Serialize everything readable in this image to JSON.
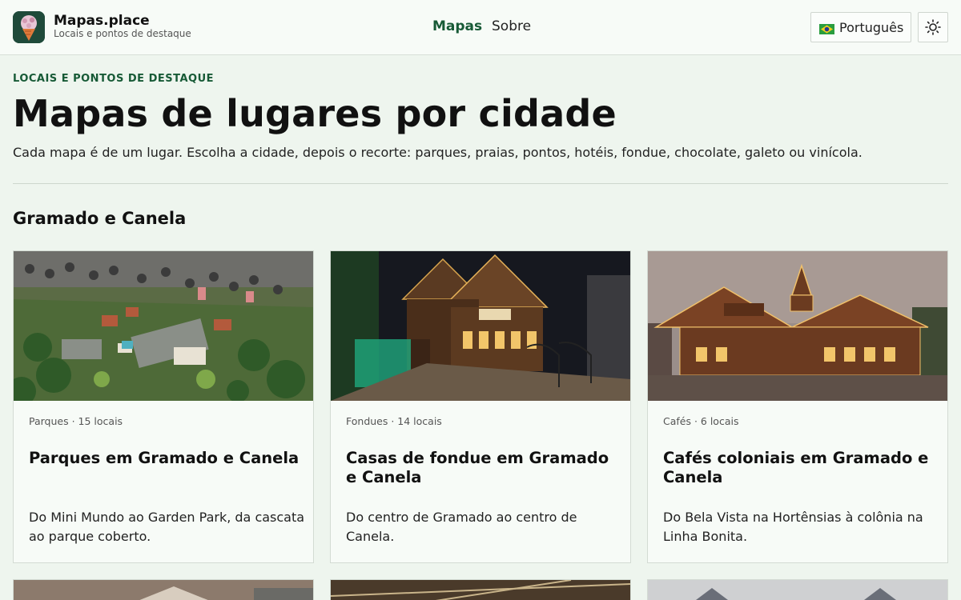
{
  "header": {
    "brand_name": "Mapas.place",
    "brand_tagline": "Locais e pontos de destaque",
    "nav": [
      {
        "label": "Mapas",
        "active": true
      },
      {
        "label": "Sobre",
        "active": false
      }
    ],
    "language_label": "Português",
    "language_flag_icon": "brazil-flag-icon",
    "theme_icon": "sun-icon"
  },
  "hero": {
    "eyebrow": "LOCAIS E PONTOS DE DESTAQUE",
    "title": "Mapas de lugares por cidade",
    "lead": "Cada mapa é de um lugar. Escolha a cidade, depois o recorte: parques, praias, pontos, hotéis, fondue, chocolate, galeto ou vinícola."
  },
  "section": {
    "city": "Gramado e Canela",
    "cards": [
      {
        "meta": "Parques · 15 locais",
        "title": "Parques em Gramado e Canela",
        "description": "Do Mini Mundo ao Garden Park, da cascata ao parque coberto."
      },
      {
        "meta": "Fondues · 14 locais",
        "title": "Casas de fondue em Gramado e Canela",
        "description": "Do centro de Gramado ao centro de Canela."
      },
      {
        "meta": "Cafés · 6 locais",
        "title": "Cafés coloniais em Gramado e Canela",
        "description": "Do Bela Vista na Hortênsias à colônia na Linha Bonita."
      }
    ]
  },
  "colors": {
    "accent": "#175a36",
    "background": "#eef5ee",
    "card": "#f7fbf7"
  }
}
